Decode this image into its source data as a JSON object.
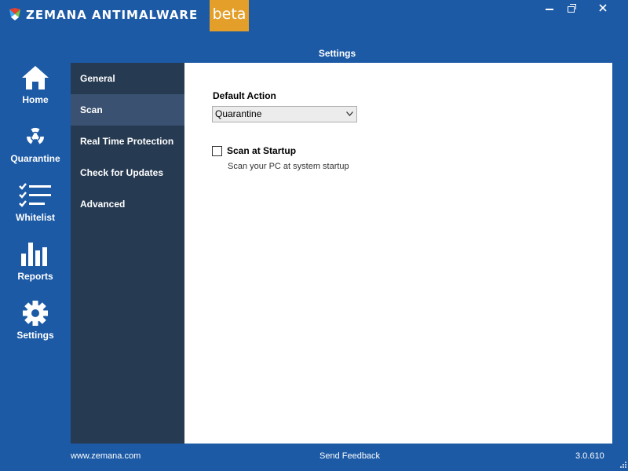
{
  "window": {
    "app_title": "ZEMANA ANTIMALWARE",
    "beta_label": "beta"
  },
  "colors": {
    "background": "#1c5aa6",
    "sidebar": "#263a52",
    "sidebar_active": "#3a5172",
    "beta": "#e39f2a",
    "content": "#ffffff"
  },
  "header": {
    "title": "Settings"
  },
  "nav": {
    "home": "Home",
    "quarantine": "Quarantine",
    "whitelist": "Whitelist",
    "reports": "Reports",
    "settings": "Settings"
  },
  "settings_menu": {
    "general": "General",
    "scan": "Scan",
    "real_time": "Real Time Protection",
    "updates": "Check for Updates",
    "advanced": "Advanced",
    "active": "Scan"
  },
  "scan_settings": {
    "default_action_label": "Default Action",
    "default_action_value": "Quarantine",
    "startup_label": "Scan at Startup",
    "startup_desc": "Scan your PC at system startup",
    "startup_checked": false
  },
  "footer": {
    "website": "www.zemana.com",
    "feedback": "Send Feedback",
    "version": "3.0.610"
  }
}
